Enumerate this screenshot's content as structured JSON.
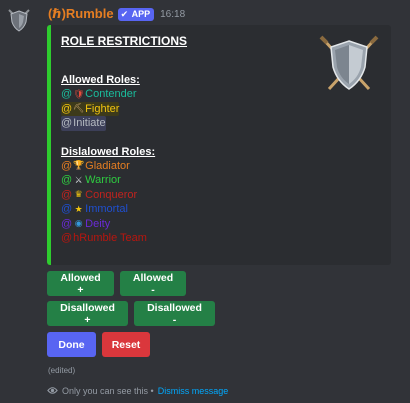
{
  "message": {
    "username": "(ℏ)Rumble",
    "app_badge": "APP",
    "timestamp": "16:18",
    "edited_label": "(edited)"
  },
  "embed": {
    "title": "ROLE RESTRICTIONS",
    "allowed_heading": "Allowed Roles:",
    "allowed_roles": [
      {
        "at": "@",
        "emoji": "shield-icon",
        "name": "Contender",
        "color": "#1abc9c"
      },
      {
        "at": "@",
        "emoji": "pickaxe-icon",
        "name": "Fighter",
        "color": "#f1c40f",
        "highlight": "#3d3a1a"
      },
      {
        "at": "@",
        "emoji": "",
        "name": "Initiate",
        "color": "#b5bac1",
        "highlight": "#3c3f58"
      }
    ],
    "disallowed_heading": "Dislalowed Roles:",
    "disallowed_roles": [
      {
        "at": "@",
        "emoji": "trophy-icon",
        "name": "Gladiator",
        "color": "#e67e22"
      },
      {
        "at": "@",
        "emoji": "crossed-swords-icon",
        "name": "Warrior",
        "color": "#2ecc40"
      },
      {
        "at": "@",
        "emoji": "crown-icon",
        "name": "Conqueror",
        "color": "#c0231e"
      },
      {
        "at": "@",
        "emoji": "star-icon",
        "name": "Immortal",
        "color": "#1f4fcf"
      },
      {
        "at": "@",
        "emoji": "orb-icon",
        "name": "Deity",
        "color": "#6a2ad6"
      },
      {
        "at": "@",
        "emoji": "",
        "name": "hRumble Team",
        "color": "#b8160f"
      }
    ],
    "accent_color": "#2ecc2e"
  },
  "buttons": {
    "allowed_add": "Allowed +",
    "allowed_remove": "Allowed -",
    "disallowed_add": "Disallowed +",
    "disallowed_remove": "Disallowed -",
    "done": "Done",
    "reset": "Reset"
  },
  "ephemeral": {
    "notice": "Only you can see this •",
    "dismiss": "Dismiss message"
  }
}
